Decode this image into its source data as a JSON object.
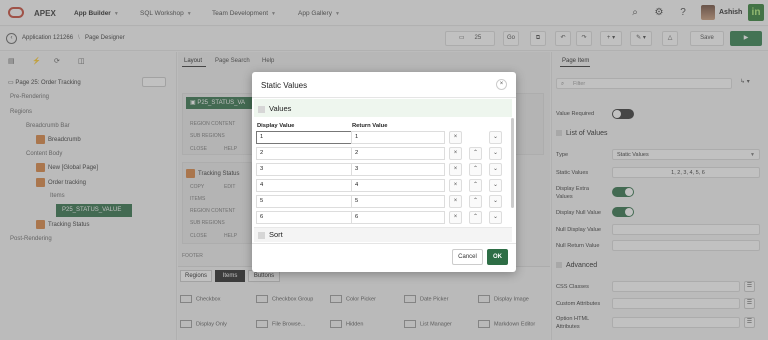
{
  "header": {
    "brand": "APEX",
    "menus": [
      "App Builder",
      "SQL Workshop",
      "Team Development",
      "App Gallery"
    ],
    "user": "Ashish",
    "logo_text": "in"
  },
  "toolbar": {
    "app_crumb": "Application 121266",
    "page_crumb": "Page Designer",
    "page_number": "25",
    "go_label": "Go",
    "save_label": "Save"
  },
  "left_pane": {
    "page_title": "Page 25: Order Tracking",
    "tree": [
      "Pre-Rendering",
      "Regions",
      "Breadcrumb Bar",
      "Breadcrumb",
      "Content Body",
      "New [Global Page]",
      "Order tracking",
      "Items",
      "P25_STATUS_VALUE",
      "Tracking Status",
      "Post-Rendering"
    ]
  },
  "center": {
    "tabs": [
      "Layout",
      "Page Search",
      "Help"
    ],
    "item_chip": "P25_STATUS_VA",
    "slot_labels": [
      "REGION CONTENT",
      "SUB REGIONS",
      "CLOSE",
      "HELP",
      "COPY",
      "EDIT",
      "ITEMS",
      "FOOTER"
    ],
    "region2_title": "Tracking Status",
    "gallery_tabs": [
      "Regions",
      "Items",
      "Buttons"
    ],
    "widgets": [
      "Checkbox",
      "Checkbox Group",
      "Color Picker",
      "Date Picker",
      "Display Image",
      "Display Only",
      "File Browse...",
      "Hidden",
      "List Manager",
      "Markdown Editor"
    ]
  },
  "right_pane": {
    "tab": "Page Item",
    "filter_placeholder": "Filter",
    "value_required": "Value Required",
    "list_of_values": "List of Values",
    "type_label": "Type",
    "type_value": "Static Values",
    "static_values_label": "Static Values",
    "static_values_value": "1, 2, 3, 4, 5, 6",
    "display_extra_label": "Display Extra Values",
    "display_null_label": "Display Null Value",
    "null_display_label": "Null Display Value",
    "null_return_label": "Null Return Value",
    "advanced": "Advanced",
    "css_classes": "CSS Classes",
    "custom_attributes": "Custom Attributes",
    "option_html_attributes": "Option HTML Attributes"
  },
  "dialog": {
    "title": "Static Values",
    "values_section": "Values",
    "col_display": "Display Value",
    "col_return": "Return Value",
    "rows": [
      {
        "display": "1",
        "return": "1"
      },
      {
        "display": "2",
        "return": "2"
      },
      {
        "display": "3",
        "return": "3"
      },
      {
        "display": "4",
        "return": "4"
      },
      {
        "display": "5",
        "return": "5"
      },
      {
        "display": "6",
        "return": "6"
      }
    ],
    "sort_section": "Sort",
    "cancel_label": "Cancel",
    "ok_label": "OK"
  },
  "colors": {
    "accent": "#2e6e46",
    "brand_red": "#c74634"
  }
}
